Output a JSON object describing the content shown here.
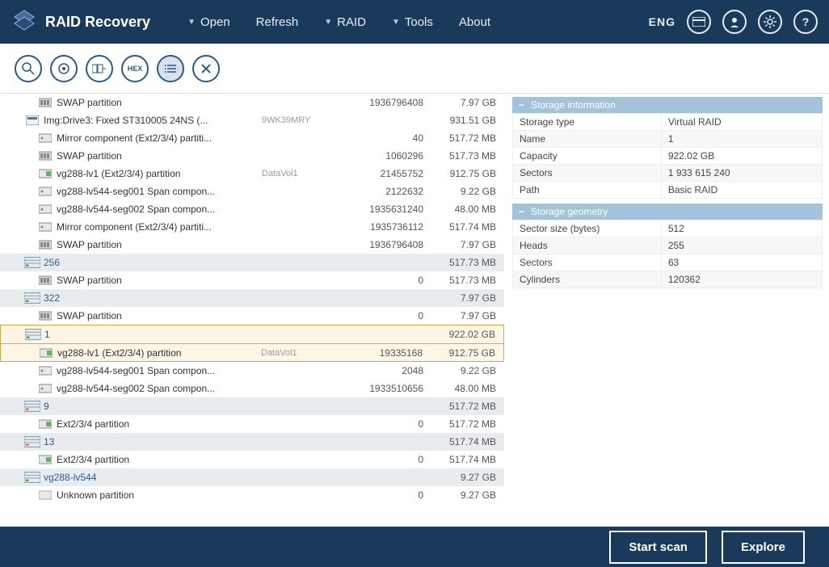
{
  "app": {
    "title": "RAID Recovery"
  },
  "menu": {
    "open": "Open",
    "refresh": "Refresh",
    "raid": "RAID",
    "tools": "Tools",
    "about": "About"
  },
  "header": {
    "lang": "ENG"
  },
  "rows": [
    {
      "type": "item",
      "indent": 2,
      "icon": "swap",
      "name": "SWAP partition",
      "vol": "",
      "sectors": "1936796408",
      "size": "7.97 GB"
    },
    {
      "type": "item",
      "indent": 1,
      "icon": "img",
      "name": "Img:Drive3: Fixed ST310005 24NS (...",
      "vol": "9WK39MRY",
      "sectors": "",
      "size": "931.51 GB"
    },
    {
      "type": "item",
      "indent": 2,
      "icon": "vol",
      "name": "Mirror component (Ext2/3/4) partiti...",
      "vol": "",
      "sectors": "40",
      "size": "517.72 MB"
    },
    {
      "type": "item",
      "indent": 2,
      "icon": "swap",
      "name": "SWAP partition",
      "vol": "",
      "sectors": "1060296",
      "size": "517.73 MB"
    },
    {
      "type": "item",
      "indent": 2,
      "icon": "volg",
      "name": "vg288-lv1 (Ext2/3/4) partition",
      "vol": "DataVol1",
      "sectors": "21455752",
      "size": "912.75 GB"
    },
    {
      "type": "item",
      "indent": 2,
      "icon": "vol",
      "name": "vg288-lv544-seg001 Span compon...",
      "vol": "",
      "sectors": "2122632",
      "size": "9.22 GB"
    },
    {
      "type": "item",
      "indent": 2,
      "icon": "vol",
      "name": "vg288-lv544-seg002 Span compon...",
      "vol": "",
      "sectors": "1935631240",
      "size": "48.00 MB"
    },
    {
      "type": "item",
      "indent": 2,
      "icon": "vol",
      "name": "Mirror component (Ext2/3/4) partiti...",
      "vol": "",
      "sectors": "1935736112",
      "size": "517.74 MB"
    },
    {
      "type": "item",
      "indent": 2,
      "icon": "swap",
      "name": "SWAP partition",
      "vol": "",
      "sectors": "1936796408",
      "size": "7.97 GB"
    },
    {
      "type": "group",
      "icon": "raid",
      "name": "256",
      "size": "517.73 MB"
    },
    {
      "type": "item",
      "indent": 2,
      "icon": "swap",
      "name": "SWAP partition",
      "vol": "",
      "sectors": "0",
      "size": "517.73 MB"
    },
    {
      "type": "group",
      "icon": "raid",
      "name": "322",
      "size": "7.97 GB"
    },
    {
      "type": "item",
      "indent": 2,
      "icon": "swap",
      "name": "SWAP partition",
      "vol": "",
      "sectors": "0",
      "size": "7.97 GB"
    },
    {
      "type": "group",
      "icon": "raid",
      "name": "1",
      "size": "922.02 GB",
      "selected": true
    },
    {
      "type": "item",
      "indent": 2,
      "icon": "volg",
      "name": "vg288-lv1 (Ext2/3/4) partition",
      "vol": "DataVol1",
      "sectors": "19335168",
      "size": "912.75 GB",
      "selchild": true
    },
    {
      "type": "item",
      "indent": 2,
      "icon": "vol",
      "name": "vg288-lv544-seg001 Span compon...",
      "vol": "",
      "sectors": "2048",
      "size": "9.22 GB"
    },
    {
      "type": "item",
      "indent": 2,
      "icon": "vol",
      "name": "vg288-lv544-seg002 Span compon...",
      "vol": "",
      "sectors": "1933510656",
      "size": "48.00 MB"
    },
    {
      "type": "group",
      "icon": "raidr",
      "name": "9",
      "size": "517.72 MB"
    },
    {
      "type": "item",
      "indent": 2,
      "icon": "volg",
      "name": "Ext2/3/4 partition",
      "vol": "",
      "sectors": "0",
      "size": "517.72 MB"
    },
    {
      "type": "group",
      "icon": "raidr",
      "name": "13",
      "size": "517.74 MB"
    },
    {
      "type": "item",
      "indent": 2,
      "icon": "volg",
      "name": "Ext2/3/4 partition",
      "vol": "",
      "sectors": "0",
      "size": "517.74 MB"
    },
    {
      "type": "group",
      "icon": "raid",
      "name": "vg288-lv544",
      "size": "9.27 GB"
    },
    {
      "type": "item",
      "indent": 2,
      "icon": "unk",
      "name": "Unknown partition",
      "vol": "",
      "sectors": "0",
      "size": "9.27 GB"
    }
  ],
  "info": {
    "section1": {
      "title": "Storage information",
      "rows": [
        [
          "Storage type",
          "Virtual RAID"
        ],
        [
          "Name",
          "1"
        ],
        [
          "Capacity",
          "922.02 GB"
        ],
        [
          "Sectors",
          "1 933 615 240"
        ],
        [
          "Path",
          "Basic RAID"
        ]
      ]
    },
    "section2": {
      "title": "Storage geometry",
      "rows": [
        [
          "Sector size (bytes)",
          "512"
        ],
        [
          "Heads",
          "255"
        ],
        [
          "Sectors",
          "63"
        ],
        [
          "Cylinders",
          "120362"
        ]
      ]
    }
  },
  "footer": {
    "start": "Start scan",
    "explore": "Explore"
  }
}
